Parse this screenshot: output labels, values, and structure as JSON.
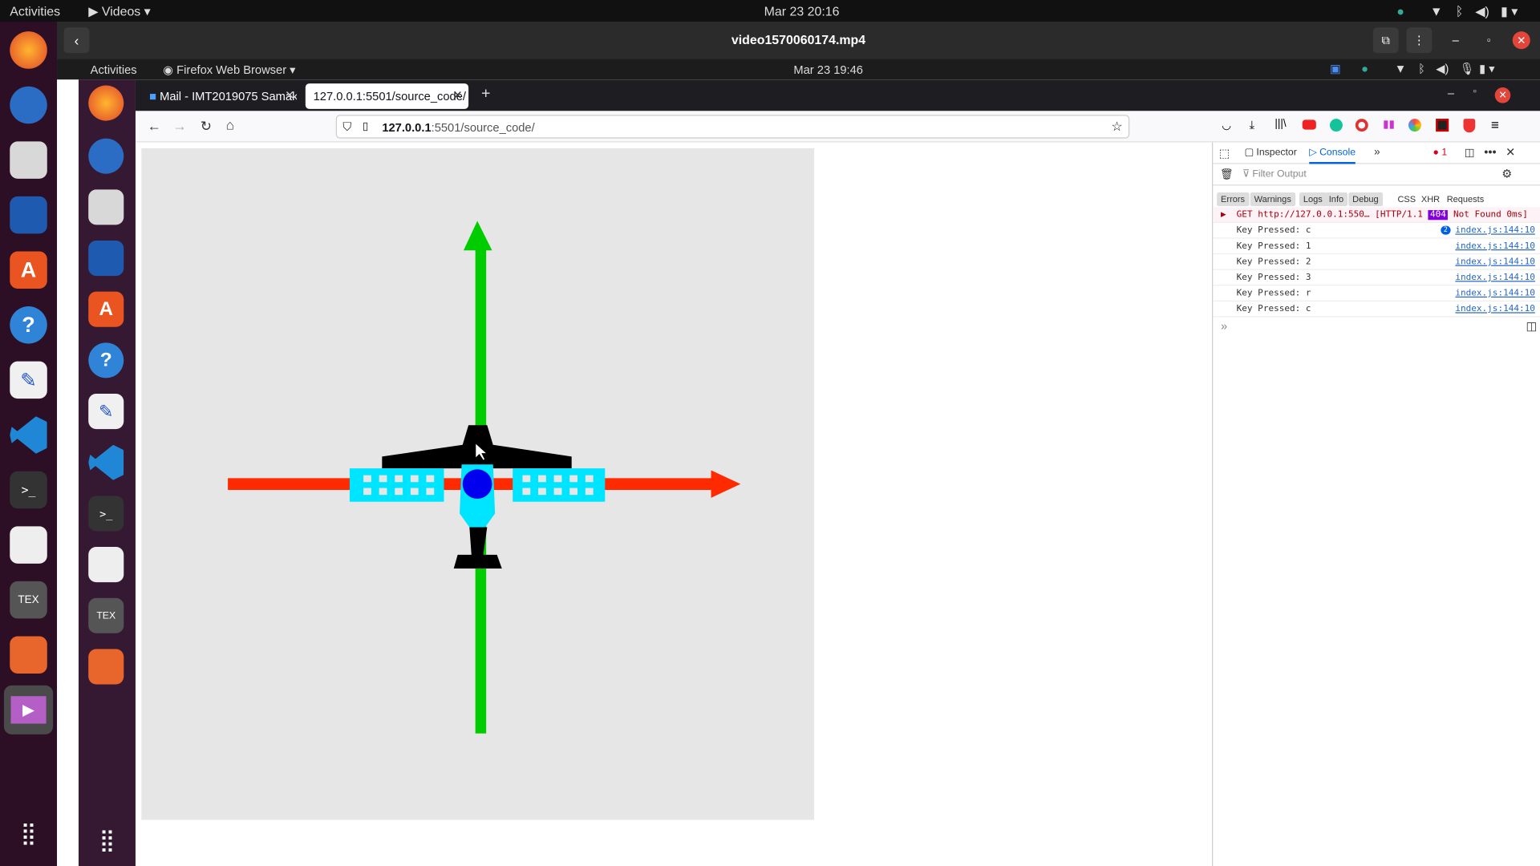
{
  "outer_topbar": {
    "activities": "Activities",
    "app_menu": "Videos",
    "datetime": "Mar 23  20:16"
  },
  "video_window": {
    "title": "video1570060174.mp4"
  },
  "inner_topbar": {
    "activities": "Activities",
    "app_menu": "Firefox Web Browser",
    "datetime": "Mar 23  19:46"
  },
  "browser": {
    "tabs": [
      {
        "label": "Mail - IMT2019075 Samak"
      },
      {
        "label": "127.0.0.1:5501/source_code/"
      }
    ],
    "url_host": "127.0.0.1",
    "url_rest": ":5501/source_code/"
  },
  "devtools": {
    "tabs": {
      "inspector": "Inspector",
      "console": "Console"
    },
    "error_count": "1",
    "filter_placeholder": "Filter Output",
    "filters": [
      "Errors",
      "Warnings",
      "Logs",
      "Info",
      "Debug",
      "CSS",
      "XHR",
      "Requests"
    ],
    "error_row": {
      "method": "GET",
      "url": "http://127.0.0.1:550…",
      "status_prefix": "[HTTP/1.1",
      "status_code": "404",
      "status_suffix": "Not Found 0ms]"
    },
    "logs": [
      {
        "msg": "Key Pressed: c",
        "badge": "2",
        "loc": "index.js:144:10"
      },
      {
        "msg": "Key Pressed: 1",
        "loc": "index.js:144:10"
      },
      {
        "msg": "Key Pressed: 2",
        "loc": "index.js:144:10"
      },
      {
        "msg": "Key Pressed: 3",
        "loc": "index.js:144:10"
      },
      {
        "msg": "Key Pressed: r",
        "loc": "index.js:144:10"
      },
      {
        "msg": "Key Pressed: c",
        "loc": "index.js:144:10"
      }
    ]
  },
  "colors": {
    "axis_y": "#00cc00",
    "axis_x": "#ff2a00",
    "airplane_body": "#000000",
    "airplane_accent": "#00e5ff",
    "airplane_hub": "#0000ee"
  }
}
